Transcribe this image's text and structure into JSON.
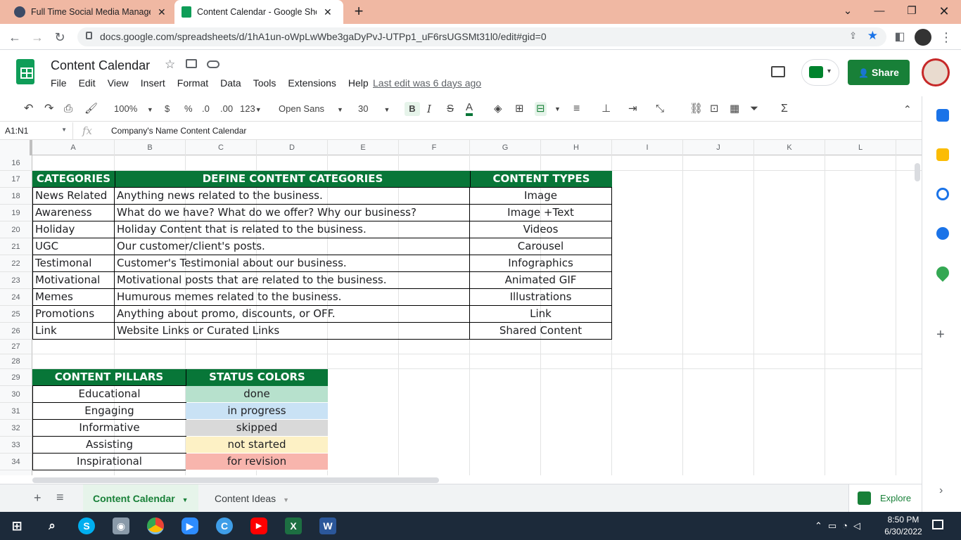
{
  "browser": {
    "tabs": [
      {
        "title": "Full Time Social Media Manager (",
        "active": false
      },
      {
        "title": "Content Calendar - Google Sheet",
        "active": true
      }
    ],
    "new_tab": "+",
    "url": "docs.google.com/spreadsheets/d/1hA1un-oWpLwWbe3gaDyPvJ-UTPp1_uF6rsUGSMt31l0/edit#gid=0"
  },
  "doc": {
    "title": "Content Calendar",
    "menus": [
      "File",
      "Edit",
      "View",
      "Insert",
      "Format",
      "Data",
      "Tools",
      "Extensions",
      "Help"
    ],
    "last_edit": "Last edit was 6 days ago",
    "share_label": "Share"
  },
  "toolbar": {
    "zoom": "100%",
    "currency": "$",
    "percent": "%",
    "dec_less": ".0",
    "dec_more": ".00",
    "format_more": "123",
    "font": "Open Sans",
    "font_size": "30",
    "bold": "B",
    "italic": "I",
    "strike": "S",
    "text_color": "A"
  },
  "formula_bar": {
    "name_box": "A1:N1",
    "fx": "fx",
    "content": "Company's Name Content Calendar"
  },
  "columns": [
    "A",
    "B",
    "C",
    "D",
    "E",
    "F",
    "G",
    "H",
    "I",
    "J",
    "K",
    "L"
  ],
  "rows": [
    "16",
    "17",
    "18",
    "19",
    "20",
    "21",
    "22",
    "23",
    "24",
    "25",
    "26",
    "27",
    "28",
    "29",
    "30",
    "31",
    "32",
    "33",
    "34"
  ],
  "table1": {
    "headers": [
      "CATEGORIES",
      "DEFINE CONTENT CATEGORIES",
      "CONTENT TYPES"
    ],
    "rows": [
      [
        "News Related",
        "Anything news related to the business.",
        "Image"
      ],
      [
        "Awareness",
        "What do we have? What do we offer? Why our business?",
        "Image +Text"
      ],
      [
        "Holiday",
        "Holiday Content that is related to the business.",
        "Videos"
      ],
      [
        "UGC",
        "Our customer/client's posts.",
        "Carousel"
      ],
      [
        "Testimonal",
        "Customer's Testimonial about our business.",
        "Infographics"
      ],
      [
        "Motivational",
        "Motivational posts that are related to the business.",
        "Animated GIF"
      ],
      [
        "Memes",
        "Humurous memes related to the business.",
        "Illustrations"
      ],
      [
        "Promotions",
        "Anything about promo, discounts, or OFF.",
        "Link"
      ],
      [
        "Link",
        "Website Links or Curated Links",
        "Shared Content"
      ]
    ]
  },
  "table2": {
    "headers": [
      "CONTENT PILLARS",
      "STATUS COLORS"
    ],
    "rows": [
      [
        "Educational",
        "done",
        "#b7e1cd"
      ],
      [
        "Engaging",
        "in progress",
        "#c9e2f5"
      ],
      [
        "Informative",
        "skipped",
        "#d9d9d9"
      ],
      [
        "Assisting",
        "not started",
        "#fdf1c5"
      ],
      [
        "Inspirational",
        "for revision",
        "#f8b5ad"
      ]
    ]
  },
  "sheet_tabs": [
    {
      "label": "Content Calendar",
      "active": true
    },
    {
      "label": "Content Ideas",
      "active": false
    }
  ],
  "explore_label": "Explore",
  "clock": {
    "time": "8:50 PM",
    "date": "6/30/2022"
  },
  "taskbar_icons": [
    "windows-start",
    "search",
    "skype",
    "camera",
    "chrome",
    "zoom",
    "cortana",
    "youtube",
    "excel",
    "word"
  ],
  "colors": {
    "header_green": "#087638",
    "share_green": "#188038"
  }
}
